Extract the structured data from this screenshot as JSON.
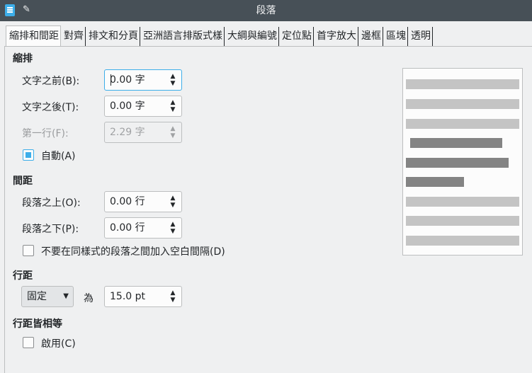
{
  "window": {
    "title": "段落"
  },
  "tabs": [
    {
      "label": "縮排和間距",
      "active": true
    },
    {
      "label": "對齊"
    },
    {
      "label": "排文和分頁"
    },
    {
      "label": "亞洲語言排版式樣"
    },
    {
      "label": "大綱與編號"
    },
    {
      "label": "定位點"
    },
    {
      "label": "首字放大"
    },
    {
      "label": "邊框"
    },
    {
      "label": "區塊"
    },
    {
      "label": "透明"
    }
  ],
  "indent": {
    "heading": "縮排",
    "before_label": "文字之前(B):",
    "before_value": "0.00 字",
    "after_label": "文字之後(T):",
    "after_value": "0.00 字",
    "first_line_label": "第一行(F):",
    "first_line_value": "2.29 字",
    "auto_label": "自動(A)",
    "auto_checked": true
  },
  "spacing": {
    "heading": "間距",
    "above_label": "段落之上(O):",
    "above_value": "0.00 行",
    "below_label": "段落之下(P):",
    "below_value": "0.00 行",
    "no_space_label": "不要在同樣式的段落之間加入空白間隔(D)",
    "no_space_checked": false
  },
  "line_spacing": {
    "heading": "行距",
    "mode": "固定",
    "of_label": "為",
    "value": "15.0 pt"
  },
  "register": {
    "heading": "行距皆相等",
    "activate_label": "啟用(C)",
    "activate_checked": false
  },
  "colors": {
    "accent": "#3daee9",
    "titlebar": "#475057",
    "background": "#eff0f1"
  },
  "icons": {
    "app": "writer-paragraph-icon",
    "pin": "pin-icon"
  }
}
